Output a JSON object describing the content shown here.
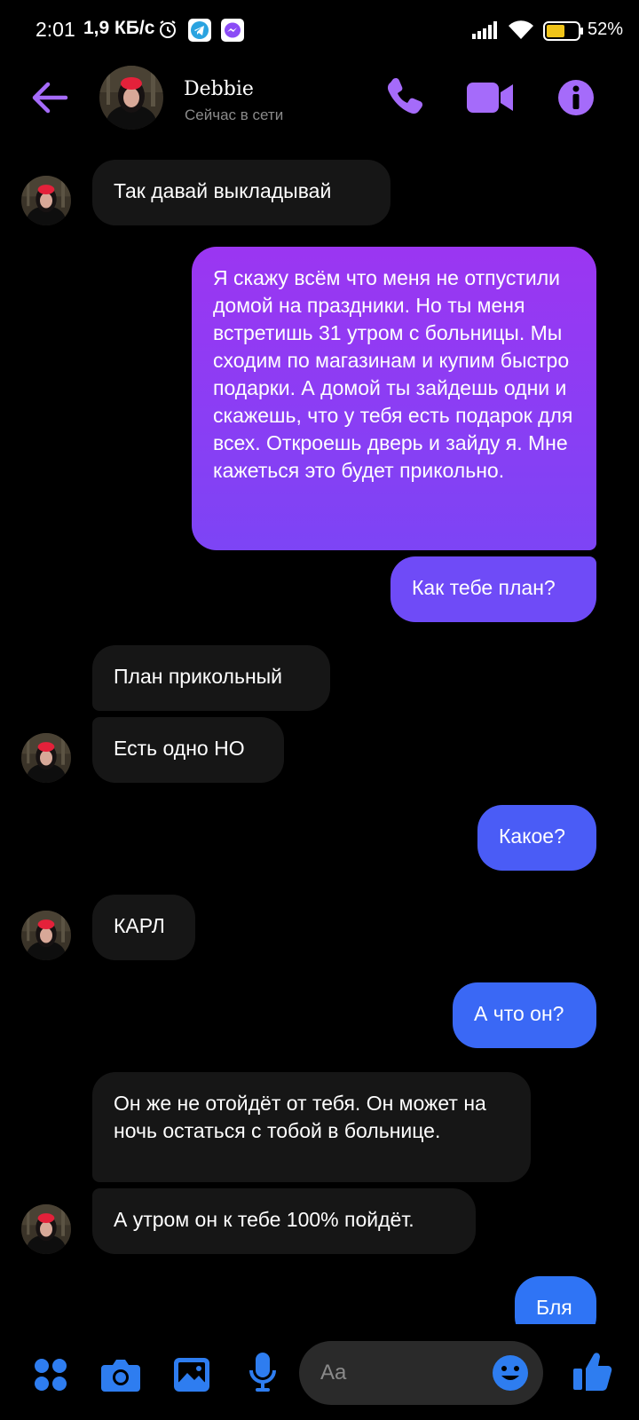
{
  "status_bar": {
    "time": "2:01",
    "speed": "1,9 КБ/с",
    "battery": "52%"
  },
  "header": {
    "name": "Debbie",
    "status": "Сейчас в сети"
  },
  "messages": [
    {
      "side": "in",
      "text": "Так давай выкладывай"
    },
    {
      "side": "out",
      "text": "Я скажу всём что меня не отпустили домой на праздники. Но ты меня встретишь 31 утром с больницы. Мы сходим по магазинам и купим быстро подарки. А домой ты зайдешь одни и скажешь, что у тебя есть подарок для всех. Откроешь дверь и зайду я. Мне кажеться это будет прикольно."
    },
    {
      "side": "out",
      "text": "Как тебе план?"
    },
    {
      "side": "in",
      "text": "План прикольный"
    },
    {
      "side": "in",
      "text": "Есть одно НО"
    },
    {
      "side": "out",
      "text": "Какое?"
    },
    {
      "side": "in",
      "text": "КАРЛ"
    },
    {
      "side": "out",
      "text": "А что он?"
    },
    {
      "side": "in",
      "text": "Он же не отойдёт от тебя. Он может на ночь остаться с тобой в больнице."
    },
    {
      "side": "in",
      "text": "А утром он к тебе 100% пойдёт."
    },
    {
      "side": "out",
      "text": "Бля"
    }
  ],
  "composer": {
    "placeholder": "Aa"
  },
  "colors": {
    "accent": "#a56bfa",
    "bubble_in": "#161616",
    "bubble_out_top": "#9a3cf0",
    "bubble_out_bottom": "#2f74f5",
    "composer_blue": "#2e7df0"
  },
  "icons": [
    "back-arrow-icon",
    "phone-icon",
    "video-icon",
    "info-icon",
    "apps-icon",
    "camera-icon",
    "gallery-icon",
    "microphone-icon",
    "emoji-icon",
    "thumbs-up-icon",
    "alarm-icon",
    "telegram-icon",
    "messenger-icon",
    "signal-icon",
    "wifi-icon",
    "battery-icon"
  ]
}
